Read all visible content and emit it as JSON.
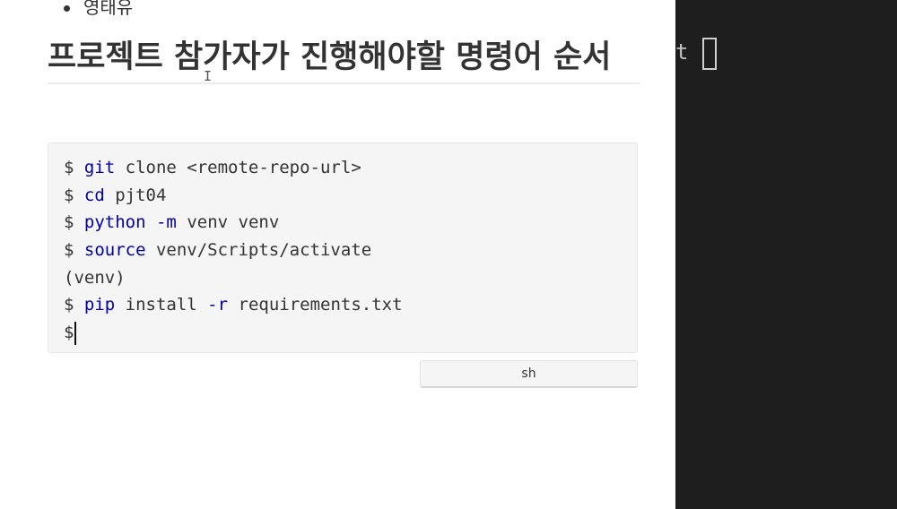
{
  "preview": {
    "bullet_text": "영태유",
    "heading": "프로젝트 참가자가 진행해야할 명령어 순서",
    "code_lines": [
      [
        {
          "t": "prompt",
          "v": "$ "
        },
        {
          "t": "cmd",
          "v": "git"
        },
        {
          "t": "arg",
          "v": " clone <remote-repo-url>"
        }
      ],
      [
        {
          "t": "prompt",
          "v": "$ "
        },
        {
          "t": "cmd",
          "v": "cd"
        },
        {
          "t": "arg",
          "v": " pjt04"
        }
      ],
      [
        {
          "t": "prompt",
          "v": "$ "
        },
        {
          "t": "cmd",
          "v": "python"
        },
        {
          "t": "arg",
          "v": " "
        },
        {
          "t": "flag",
          "v": "-m"
        },
        {
          "t": "arg",
          "v": " venv venv"
        }
      ],
      [
        {
          "t": "prompt",
          "v": "$ "
        },
        {
          "t": "cmd",
          "v": "source"
        },
        {
          "t": "arg",
          "v": " venv/Scripts/activate"
        }
      ],
      [
        {
          "t": "arg",
          "v": "(venv)"
        }
      ],
      [
        {
          "t": "prompt",
          "v": "$ "
        },
        {
          "t": "cmd",
          "v": "pip"
        },
        {
          "t": "arg",
          "v": " install "
        },
        {
          "t": "flag",
          "v": "-r"
        },
        {
          "t": "arg",
          "v": " requirements.txt"
        }
      ],
      [
        {
          "t": "prompt",
          "v": "$"
        }
      ]
    ],
    "code_language": "sh"
  },
  "terminal": {
    "visible_text": "t"
  }
}
